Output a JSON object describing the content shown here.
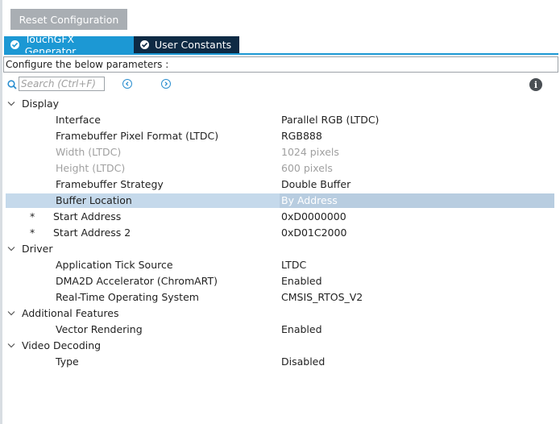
{
  "reset_button": "Reset Configuration",
  "tabs": [
    {
      "label": "TouchGFX Generator",
      "active": true
    },
    {
      "label": "User Constants",
      "active": false
    }
  ],
  "config_header": "Configure the below parameters :",
  "search": {
    "placeholder": "Search (Ctrl+F)",
    "value": ""
  },
  "tree": {
    "display": {
      "label": "Display",
      "rows": [
        {
          "label": "Interface",
          "value": "Parallel RGB (LTDC)"
        },
        {
          "label": "Framebuffer Pixel Format (LTDC)",
          "value": "RGB888"
        },
        {
          "label": "Width (LTDC)",
          "value": "1024 pixels"
        },
        {
          "label": "Height (LTDC)",
          "value": "600 pixels"
        },
        {
          "label": "Framebuffer Strategy",
          "value": "Double Buffer"
        },
        {
          "label": "Buffer Location",
          "value": "By Address"
        },
        {
          "marker": "*",
          "label": "Start Address",
          "value": "0xD0000000"
        },
        {
          "marker": "*",
          "label": "Start Address 2",
          "value": "0xD01C2000"
        }
      ]
    },
    "driver": {
      "label": "Driver",
      "rows": [
        {
          "label": "Application Tick Source",
          "value": "LTDC"
        },
        {
          "label": "DMA2D Accelerator (ChromART)",
          "value": "Enabled"
        },
        {
          "label": "Real-Time Operating System",
          "value": "CMSIS_RTOS_V2"
        }
      ]
    },
    "additional": {
      "label": "Additional Features",
      "rows": [
        {
          "label": "Vector Rendering",
          "value": "Enabled"
        }
      ]
    },
    "video": {
      "label": "Video Decoding",
      "rows": [
        {
          "label": "Type",
          "value": "Disabled"
        }
      ]
    }
  },
  "colors": {
    "accent": "#1c98d4",
    "tab_inactive": "#0e2a44",
    "selection": "#c5d9eb"
  },
  "icons": [
    "search-icon",
    "check-circle-icon",
    "prev-icon",
    "next-icon",
    "info-icon",
    "chevron-down-icon"
  ]
}
